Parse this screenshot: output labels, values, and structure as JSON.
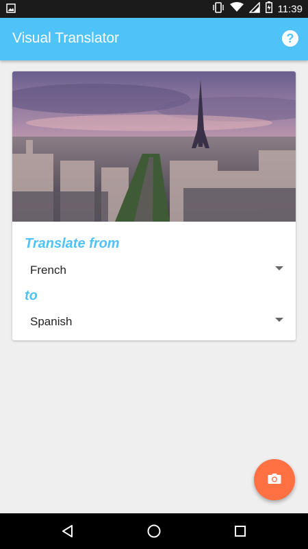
{
  "status_bar": {
    "time": "11:39",
    "icons": [
      "image-notification-icon",
      "vibrate-icon",
      "wifi-icon",
      "signal-icon",
      "battery-charging-icon"
    ]
  },
  "app_bar": {
    "title": "Visual Translator",
    "help_icon": "help-icon",
    "help_glyph": "?"
  },
  "card": {
    "image": "paris-eiffel-tower-cityscape",
    "translate_from_label": "Translate from",
    "from_language": "French",
    "to_label": "to",
    "to_language": "Spanish"
  },
  "fab": {
    "icon": "camera-icon"
  },
  "nav_bar": {
    "icons": [
      "back-icon",
      "home-icon",
      "recents-icon"
    ]
  },
  "colors": {
    "primary": "#4fc3f7",
    "accent": "#ff7043",
    "background": "#efefef"
  }
}
